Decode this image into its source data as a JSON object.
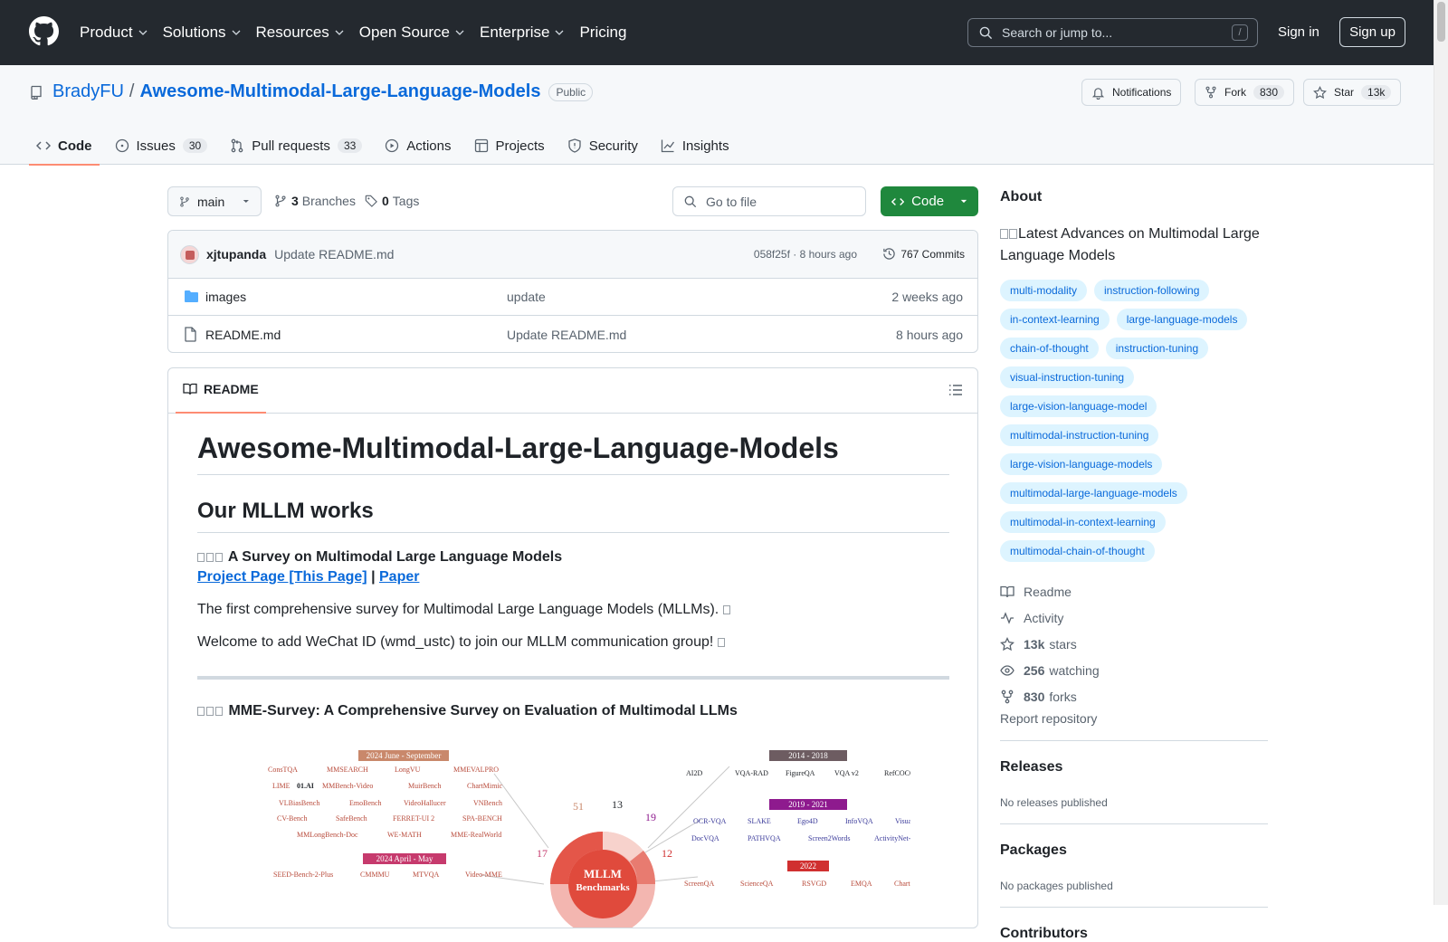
{
  "nav": {
    "items": [
      "Product",
      "Solutions",
      "Resources",
      "Open Source",
      "Enterprise",
      "Pricing"
    ],
    "search_placeholder": "Search or jump to...",
    "search_shortcut": "/",
    "signin": "Sign in",
    "signup": "Sign up"
  },
  "repo": {
    "owner": "BradyFU",
    "separator": "/",
    "name": "Awesome-Multimodal-Large-Language-Models",
    "visibility": "Public",
    "notifications": "Notifications",
    "fork_label": "Fork",
    "fork_count": "830",
    "star_label": "Star",
    "star_count": "13k"
  },
  "tabs": [
    {
      "label": "Code",
      "icon": "code-icon"
    },
    {
      "label": "Issues",
      "count": "30",
      "icon": "issue-icon"
    },
    {
      "label": "Pull requests",
      "count": "33",
      "icon": "pull-request-icon"
    },
    {
      "label": "Actions",
      "icon": "play-icon"
    },
    {
      "label": "Projects",
      "icon": "table-icon"
    },
    {
      "label": "Security",
      "icon": "shield-icon"
    },
    {
      "label": "Insights",
      "icon": "graph-icon"
    }
  ],
  "toolbar": {
    "branch": "main",
    "branches_count": "3",
    "branches_label": "Branches",
    "tags_count": "0",
    "tags_label": "Tags",
    "goto_placeholder": "Go to file",
    "code_label": "Code"
  },
  "commit": {
    "author": "xjtupanda",
    "message": "Update README.md",
    "meta": "058f25f · 8 hours ago",
    "commits": "767 Commits"
  },
  "files": [
    {
      "name": "images",
      "type": "folder",
      "message": "update",
      "date": "2 weeks ago"
    },
    {
      "name": "README.md",
      "type": "file",
      "message": "Update README.md",
      "date": "8 hours ago"
    }
  ],
  "readme": {
    "tab": "README",
    "h1": "Awesome-Multimodal-Large-Language-Models",
    "h2": "Our MLLM works",
    "work1_title": "A Survey on Multimodal Large Language Models",
    "work1_link1": "Project Page [This Page]",
    "work1_sep": "|",
    "work1_link2": "Paper",
    "p1": "The first comprehensive survey for Multimodal Large Language Models (MLLMs).",
    "p2": "Welcome to add WeChat ID (wmd_ustc) to join our MLLM communication group!",
    "work2_title": "MME-Survey: A Comprehensive Survey on Evaluation of Multimodal LLMs",
    "figure": {
      "tag_a": "2024   June - September",
      "tag_b": "2014 - 2018",
      "tag_c": "2019 - 2021",
      "tag_d": "2024   April - May",
      "tag_e": "2022",
      "center1": "MLLM",
      "center2": "Benchmarks",
      "n51": "51",
      "n13": "13",
      "n19": "19",
      "n17": "17",
      "n12": "12",
      "left_row1": [
        "ConsTQA",
        "MMSEARCH",
        "LongVU",
        "MMEVALPRO"
      ],
      "left_row2": [
        "LIME",
        "01.AI",
        "MMBench-Video",
        "MuirBench",
        "ChartMimic"
      ],
      "left_row3": [
        "VLBiasBench",
        "EmoBench",
        "VideoHallucer",
        "VNBench"
      ],
      "left_row4": [
        "CV-Bench",
        "SafeBench",
        "FERRET-UI 2",
        "SPA-BENCH"
      ],
      "left_row5": [
        "MMLongBench-Doc",
        "WE-MATH",
        "MME-RealWorld"
      ],
      "left_row6": [
        "SEED-Bench-2-Plus",
        "CMMMU",
        "MTVQA",
        "Video-MME"
      ],
      "right_row1": [
        "AI2D",
        "VQA-RAD",
        "FigureQA",
        "VQA v2",
        "RefCOCO"
      ],
      "right_row2": [
        "OCR-VQA",
        "SLAKE",
        "Ego4D",
        "InfoVQA",
        "VisualMRC"
      ],
      "right_row3": [
        "DocVQA",
        "PATHVQA",
        "Screen2Words",
        "ActivityNet-QA"
      ],
      "right_row4": [
        "ScreenQA",
        "ScienceQA",
        "RSVGD",
        "EMQA",
        "ChartQA"
      ]
    }
  },
  "about": {
    "title": "About",
    "description": "Latest Advances on Multimodal Large Language Models",
    "topics": [
      "multi-modality",
      "instruction-following",
      "in-context-learning",
      "large-language-models",
      "chain-of-thought",
      "instruction-tuning",
      "visual-instruction-tuning",
      "large-vision-language-model",
      "multimodal-instruction-tuning",
      "large-vision-language-models",
      "multimodal-large-language-models",
      "multimodal-in-context-learning",
      "multimodal-chain-of-thought"
    ],
    "readme": "Readme",
    "activity": "Activity",
    "stars_count": "13k",
    "stars_label": "stars",
    "watching_count": "256",
    "watching_label": "watching",
    "forks_count": "830",
    "forks_label": "forks",
    "report": "Report repository"
  },
  "releases": {
    "title": "Releases",
    "empty": "No releases published"
  },
  "packages": {
    "title": "Packages",
    "empty": "No packages published"
  },
  "contributors": {
    "title": "Contributors"
  }
}
